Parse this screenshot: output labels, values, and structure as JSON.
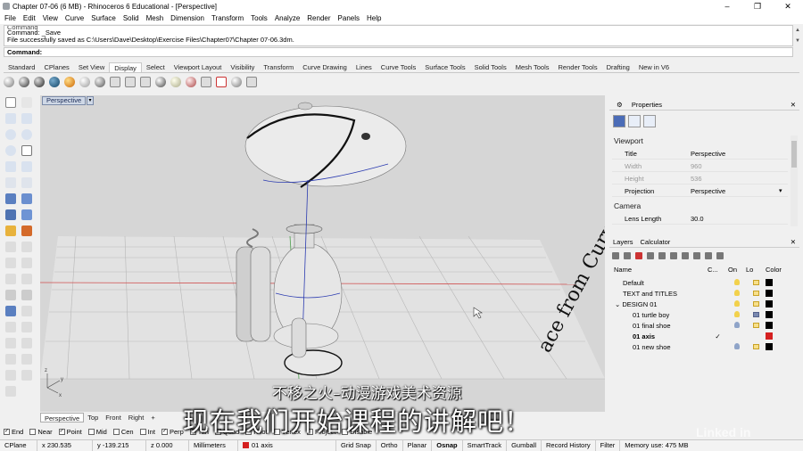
{
  "window": {
    "title": "Chapter 07-06 (6 MB) - Rhinoceros 6 Educational - [Perspective]",
    "minimize": "–",
    "maximize": "❐",
    "close": "✕"
  },
  "menu": [
    "File",
    "Edit",
    "View",
    "Curve",
    "Surface",
    "Solid",
    "Mesh",
    "Dimension",
    "Transform",
    "Tools",
    "Analyze",
    "Render",
    "Panels",
    "Help"
  ],
  "command": {
    "history": [
      "Command",
      "Command: _Save",
      "File successfully saved as C:\\Users\\Dave\\Desktop\\Exercise Files\\Chapter07\\Chapter 07-06.3dm."
    ],
    "prompt": "Command:"
  },
  "toolbar_tabs": {
    "items": [
      "Standard",
      "CPlanes",
      "Set View",
      "Display",
      "Select",
      "Viewport Layout",
      "Visibility",
      "Transform",
      "Curve Drawing",
      "Lines",
      "Curve Tools",
      "Surface Tools",
      "Solid Tools",
      "Mesh Tools",
      "Render Tools",
      "Drafting",
      "New in V6"
    ],
    "active": "Display"
  },
  "viewport": {
    "label": "Perspective",
    "text3d": "ace from Curve Network"
  },
  "viewport_tabs": {
    "items": [
      "Perspective",
      "Top",
      "Front",
      "Right"
    ],
    "active": "Perspective",
    "add": "+"
  },
  "osnap": [
    {
      "label": "End",
      "checked": true
    },
    {
      "label": "Near",
      "checked": false
    },
    {
      "label": "Point",
      "checked": true
    },
    {
      "label": "Mid",
      "checked": false
    },
    {
      "label": "Cen",
      "checked": false
    },
    {
      "label": "Int",
      "checked": false
    },
    {
      "label": "Perp",
      "checked": true
    },
    {
      "label": "Tan",
      "checked": false
    },
    {
      "label": "Quad",
      "checked": false
    },
    {
      "label": "Knot",
      "checked": false
    },
    {
      "label": "Vertex",
      "checked": false
    },
    {
      "label": "Project",
      "checked": false
    },
    {
      "label": "Disable",
      "checked": false
    }
  ],
  "status": {
    "cplane": "CPlane",
    "x": "x 230.535",
    "y": "y -139.215",
    "z": "z 0.000",
    "units": "Millimeters",
    "layer": "01 axis",
    "toggles": [
      "Grid Snap",
      "Ortho",
      "Planar",
      "Osnap",
      "SmartTrack",
      "Gumball",
      "Record History",
      "Filter"
    ],
    "active_toggle": "Osnap",
    "memory": "Memory use: 475 MB",
    "layer_color": "#d42020"
  },
  "properties": {
    "tab": "Properties",
    "section": "Viewport",
    "rows": [
      {
        "k": "Title",
        "v": "Perspective",
        "dis": false
      },
      {
        "k": "Width",
        "v": "960",
        "dis": true
      },
      {
        "k": "Height",
        "v": "536",
        "dis": true
      },
      {
        "k": "Projection",
        "v": "Perspective",
        "dis": false
      }
    ],
    "camera_section": "Camera",
    "camera_rows": [
      {
        "k": "Lens Length",
        "v": "30.0",
        "dis": false
      }
    ]
  },
  "layers": {
    "tabs": [
      "Layers",
      "Calculator"
    ],
    "columns": {
      "name": "Name",
      "current": "C...",
      "on": "On",
      "lock": "Lo",
      "color": "Color"
    },
    "rows": [
      {
        "name": "Default",
        "indent": 0,
        "current": false,
        "bold": false,
        "color": "#000000",
        "lock": "open"
      },
      {
        "name": "TEXT and TITLES",
        "indent": 0,
        "current": false,
        "bold": false,
        "color": "#000000",
        "lock": "open"
      },
      {
        "name": "DESIGN 01",
        "indent": 0,
        "current": false,
        "bold": false,
        "color": "#000000",
        "lock": "open",
        "expander": "⌄"
      },
      {
        "name": "01 turtle boy",
        "indent": 1,
        "current": false,
        "bold": false,
        "color": "#000000",
        "lock": "closed"
      },
      {
        "name": "01 final shoe",
        "indent": 1,
        "current": false,
        "bold": false,
        "color": "#000000",
        "lock": "open"
      },
      {
        "name": "01 axis",
        "indent": 1,
        "current": true,
        "bold": true,
        "color": "#d42020",
        "lock": "open"
      },
      {
        "name": "01 new shoe",
        "indent": 1,
        "current": false,
        "bold": false,
        "color": "#000000",
        "lock": "open"
      }
    ],
    "current_mark": "✓"
  },
  "overlay": {
    "line1": "不移之火–动漫游戏美术资源",
    "line2": "现在我们开始课程的讲解吧！",
    "watermark": "Linked in"
  }
}
